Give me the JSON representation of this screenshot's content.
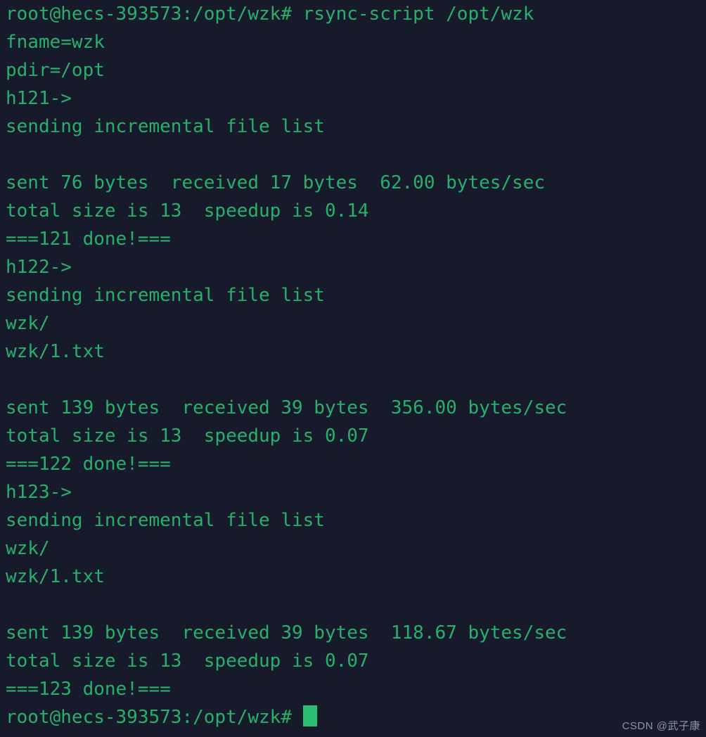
{
  "terminal": {
    "theme": {
      "background": "#171a2b",
      "foreground": "#27b06a",
      "cursor": "#2bbd72",
      "watermark_color": "#8d93a8"
    },
    "prompt": "root@hecs-393573:/opt/wzk#",
    "command": "rsync-script /opt/wzk",
    "lines": [
      "root@hecs-393573:/opt/wzk# rsync-script /opt/wzk",
      "fname=wzk",
      "pdir=/opt",
      "h121->",
      "sending incremental file list",
      "",
      "sent 76 bytes  received 17 bytes  62.00 bytes/sec",
      "total size is 13  speedup is 0.14",
      "===121 done!===",
      "h122->",
      "sending incremental file list",
      "wzk/",
      "wzk/1.txt",
      "",
      "sent 139 bytes  received 39 bytes  356.00 bytes/sec",
      "total size is 13  speedup is 0.07",
      "===122 done!===",
      "h123->",
      "sending incremental file list",
      "wzk/",
      "wzk/1.txt",
      "",
      "sent 139 bytes  received 39 bytes  118.67 bytes/sec",
      "total size is 13  speedup is 0.07",
      "===123 done!==="
    ],
    "final_prompt": "root@hecs-393573:/opt/wzk# ",
    "cursor_visible": true
  },
  "watermark": {
    "text": "CSDN @武子康"
  }
}
